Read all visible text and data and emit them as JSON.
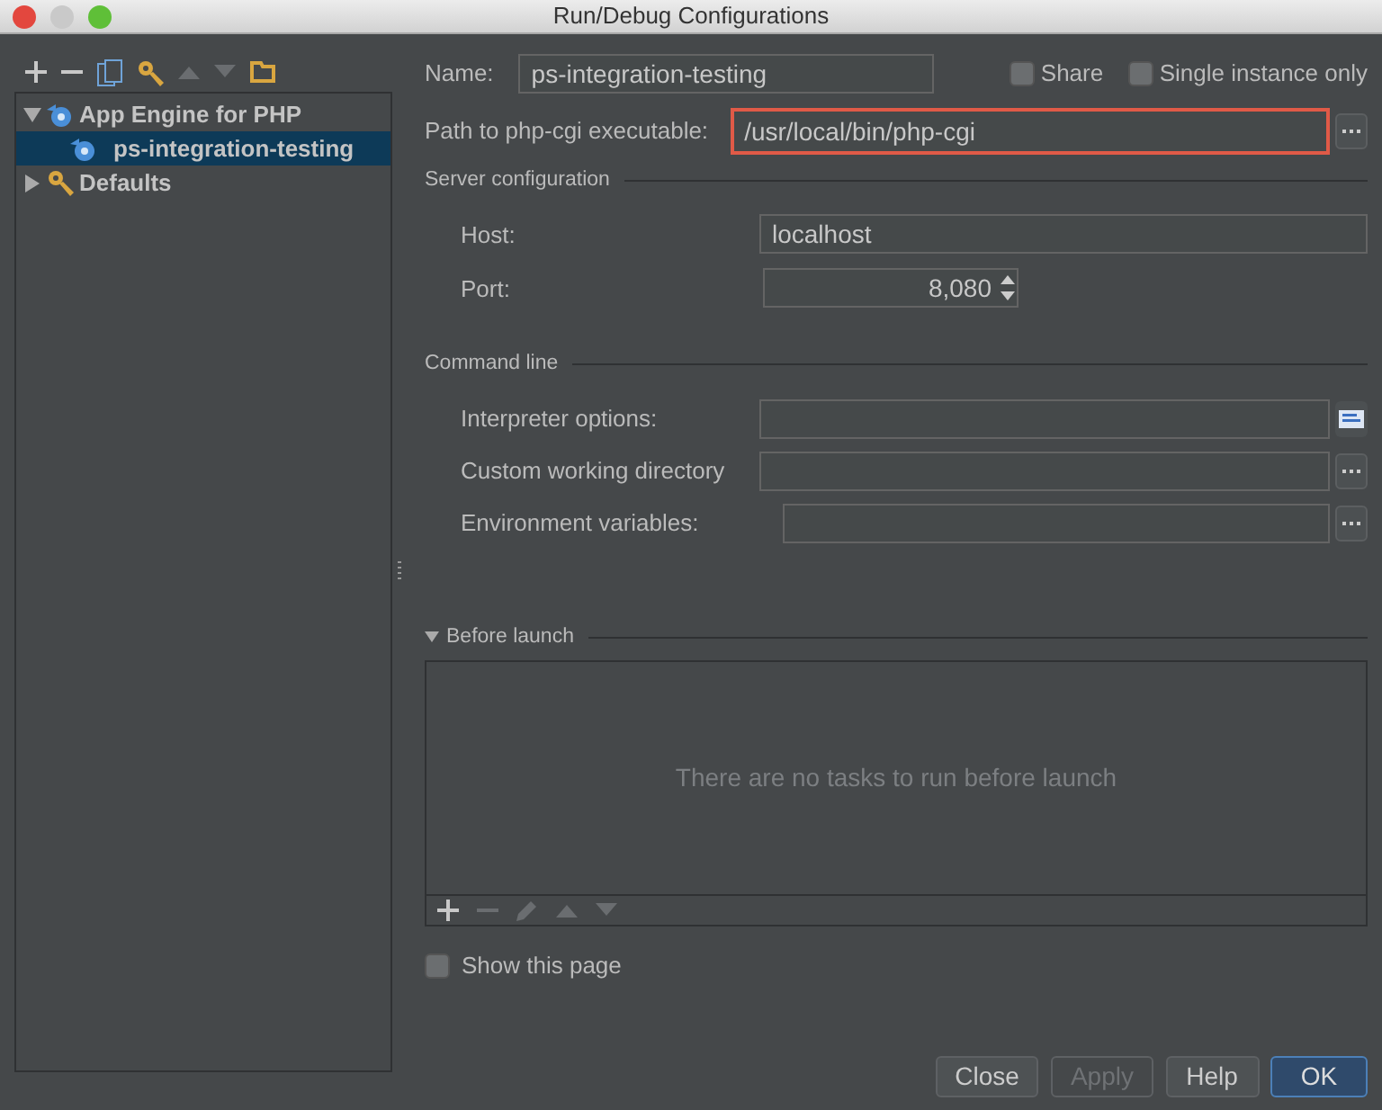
{
  "window": {
    "title": "Run/Debug Configurations"
  },
  "toolbar": [
    {
      "kind": "add",
      "disabled": false
    },
    {
      "kind": "remove",
      "disabled": false
    },
    {
      "kind": "copy",
      "disabled": false
    },
    {
      "kind": "defaults",
      "disabled": false
    },
    {
      "kind": "up",
      "disabled": true
    },
    {
      "kind": "down",
      "disabled": true
    },
    {
      "kind": "folder",
      "disabled": false
    }
  ],
  "tree": [
    {
      "label": "App Engine for PHP",
      "kind": "appengine",
      "expanded": true,
      "selected": false,
      "children": [
        {
          "label": "ps-integration-testing",
          "kind": "appengine",
          "selected": true
        }
      ]
    },
    {
      "label": "Defaults",
      "kind": "defaults",
      "expanded": false,
      "selected": false
    }
  ],
  "name_field": {
    "label": "Name:",
    "value": "ps-integration-testing"
  },
  "options": [
    {
      "label": "Share",
      "checked": false
    },
    {
      "label": "Single instance only",
      "checked": false
    }
  ],
  "php_cgi": {
    "label": "Path to php-cgi executable:",
    "value": "/usr/local/bin/php-cgi",
    "highlighted": true
  },
  "server_configuration": {
    "title": "Server configuration",
    "host": {
      "label": "Host:",
      "value": "localhost"
    },
    "port": {
      "label": "Port:",
      "value": "8,080"
    }
  },
  "command_line": {
    "title": "Command line",
    "fields": [
      {
        "label": "Interpreter options:",
        "kind": "expand"
      },
      {
        "label": "Custom working directory",
        "kind": "browse"
      },
      {
        "label": "Environment variables:",
        "kind": "browse"
      }
    ]
  },
  "before_launch": {
    "title": "Before launch",
    "expanded": true,
    "empty_text": "There are no tasks to run before launch",
    "toolbar": [
      {
        "kind": "add",
        "disabled": false
      },
      {
        "kind": "remove",
        "disabled": true
      },
      {
        "kind": "edit",
        "disabled": true
      },
      {
        "kind": "up",
        "disabled": true
      },
      {
        "kind": "down",
        "disabled": true
      }
    ]
  },
  "show_this_page": {
    "label": "Show this page",
    "checked": false
  },
  "buttons": [
    {
      "label": "Close",
      "disabled": false,
      "default": false
    },
    {
      "label": "Apply",
      "disabled": true,
      "default": false
    },
    {
      "label": "Help",
      "disabled": false,
      "default": false
    },
    {
      "label": "OK",
      "disabled": false,
      "default": true
    }
  ]
}
